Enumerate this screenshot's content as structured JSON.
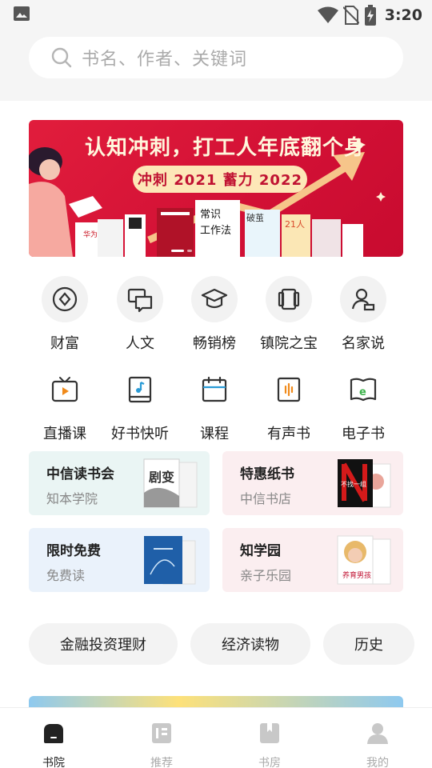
{
  "status_bar": {
    "time": "3:20"
  },
  "search": {
    "placeholder": "书名、作者、关键词"
  },
  "banner": {
    "headline": "认知冲刺，打工人年底翻个身",
    "pill": "冲刺 2021   蓄力 2022",
    "book_titles": [
      "华为团队工作法",
      "常识工作法",
      "破茧时刻",
      "21人间隔年"
    ]
  },
  "categories_row1": [
    {
      "label": "财富",
      "icon": "coin-icon"
    },
    {
      "label": "人文",
      "icon": "chat-bubbles-icon"
    },
    {
      "label": "畅销榜",
      "icon": "graduation-cap-icon"
    },
    {
      "label": "镇院之宝",
      "icon": "book-scroll-icon"
    },
    {
      "label": "名家说",
      "icon": "person-icon"
    }
  ],
  "categories_row2": [
    {
      "label": "直播课",
      "icon": "tv-play-icon"
    },
    {
      "label": "好书快听",
      "icon": "music-book-icon"
    },
    {
      "label": "课程",
      "icon": "calendar-icon"
    },
    {
      "label": "有声书",
      "icon": "audio-wave-icon"
    },
    {
      "label": "电子书",
      "icon": "ebook-icon"
    }
  ],
  "cards": [
    {
      "title": "中信读书会",
      "subtitle": "知本学院",
      "bg": "#eaf5f4",
      "cover_text": "剧变"
    },
    {
      "title": "特惠纸书",
      "subtitle": "中信书店",
      "bg": "#fbeef0",
      "cover_text": "不找一组"
    },
    {
      "title": "限时免费",
      "subtitle": "免费读",
      "bg": "#eaf2fb"
    },
    {
      "title": "知学园",
      "subtitle": "亲子乐园",
      "bg": "#fbeef0",
      "cover_text": "养育男孩"
    }
  ],
  "chips": [
    "金融投资理财",
    "经济读物",
    "历史"
  ],
  "tabs": [
    {
      "label": "书院",
      "icon": "home-icon",
      "active": true
    },
    {
      "label": "推荐",
      "icon": "recommend-icon",
      "active": false
    },
    {
      "label": "书房",
      "icon": "bookshelf-icon",
      "active": false
    },
    {
      "label": "我的",
      "icon": "profile-icon",
      "active": false
    }
  ],
  "colors": {
    "accent": "#222222",
    "banner_red": "#d21035",
    "inactive": "#aaaaaa"
  }
}
